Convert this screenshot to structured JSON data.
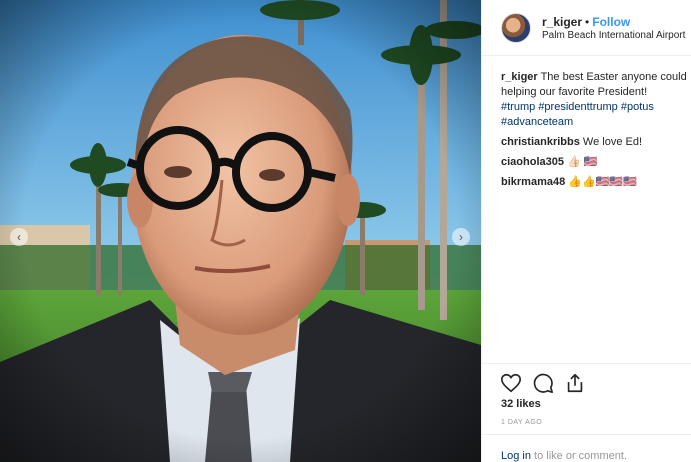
{
  "post": {
    "username": "r_kiger",
    "separator": "•",
    "follow_label": "Follow",
    "location": "Palm Beach International Airport"
  },
  "caption": {
    "username": "r_kiger",
    "line1": "The best Easter anyone could",
    "line2": "helping our favorite President!",
    "hashtags_line1": [
      "#trump",
      "#presidenttrump",
      "#potus"
    ],
    "hashtags_line2": [
      "#advanceteam"
    ]
  },
  "comments": [
    {
      "username": "christiankribbs",
      "text": "We love Ed!"
    },
    {
      "username": "ciaohola305",
      "text": "👍🏻 🇺🇸"
    },
    {
      "username": "bikrmama48",
      "text": "👍👍🇺🇸🇺🇸🇺🇸"
    }
  ],
  "actions": {
    "like_icon": "heart-icon",
    "comment_icon": "comment-icon",
    "share_icon": "share-icon"
  },
  "likes": "32 likes",
  "time": "1 DAY AGO",
  "footer": {
    "login_label": "Log in",
    "text": "to like or comment."
  },
  "carousel": {
    "prev_icon": "chevron-left-icon",
    "next_icon": "chevron-right-icon",
    "prev_glyph": "‹",
    "next_glyph": "›"
  },
  "colors": {
    "link": "#3897f0",
    "hashtag": "#003569",
    "text": "#262626",
    "muted": "#999999"
  }
}
